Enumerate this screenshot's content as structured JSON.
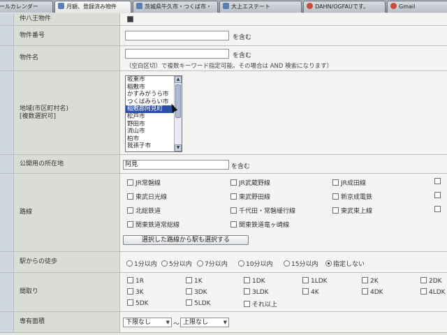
{
  "tabs": [
    {
      "label": "ールカレンダー"
    },
    {
      "label": "月額、登録済み物件"
    },
    {
      "label": "茨城県牛久市・つくば市・"
    },
    {
      "label": "大上エステート"
    },
    {
      "label": "DAHN/OGFAUです。"
    },
    {
      "label": "Gmail"
    }
  ],
  "rows": {
    "hachioji": {
      "label": "仲八王物件"
    },
    "number": {
      "label": "物件番号",
      "value": "",
      "suffix": "を含む"
    },
    "name": {
      "label": "物件名",
      "value": "",
      "suffix": "を含む",
      "hint": "（空白区切）で複数キーワード指定可能。その場合は AND 検索になります）"
    },
    "area": {
      "label": "地域(市区町村名)\n[複数選択可]",
      "options": [
        "坂東市",
        "稲敷市",
        "かすみがうら市",
        "つくばみらい市",
        "稲敷郡阿見町",
        "松戸市",
        "野田市",
        "流山市",
        "柏市",
        "我孫子市"
      ],
      "selected_index": 4
    },
    "public": {
      "label": "公開用の所在地",
      "value": "阿見",
      "suffix": "を含む"
    },
    "lines": {
      "label": "路線",
      "col1": [
        "JR常磐線",
        "東武日光線",
        "北総鉄道",
        "関東鉄道常総線"
      ],
      "col2": [
        "JR武蔵野線",
        "東武野田線",
        "千代田・常磐緩行線",
        "関東鉄道竜ヶ崎線"
      ],
      "col3": [
        "JR成田線",
        "新京成電鉄",
        "東武東上線"
      ],
      "button": "選択した路線から駅も選択する"
    },
    "walk": {
      "label": "駅からの徒歩",
      "options": [
        "1分以内",
        "5分以内",
        "7分以内",
        "10分以内",
        "15分以内",
        "指定しない"
      ],
      "selected_index": 5
    },
    "layout": {
      "label": "間取り",
      "options": [
        "1R",
        "1K",
        "1DK",
        "1LDK",
        "2K",
        "2DK",
        "3K",
        "3DK",
        "3LDK",
        "4K",
        "4DK",
        "4LDK",
        "5DK",
        "5LDK",
        "それ以上"
      ]
    },
    "size": {
      "label": "専有面積",
      "min": "下限なし",
      "max": "上限なし",
      "sep": "〜"
    }
  }
}
